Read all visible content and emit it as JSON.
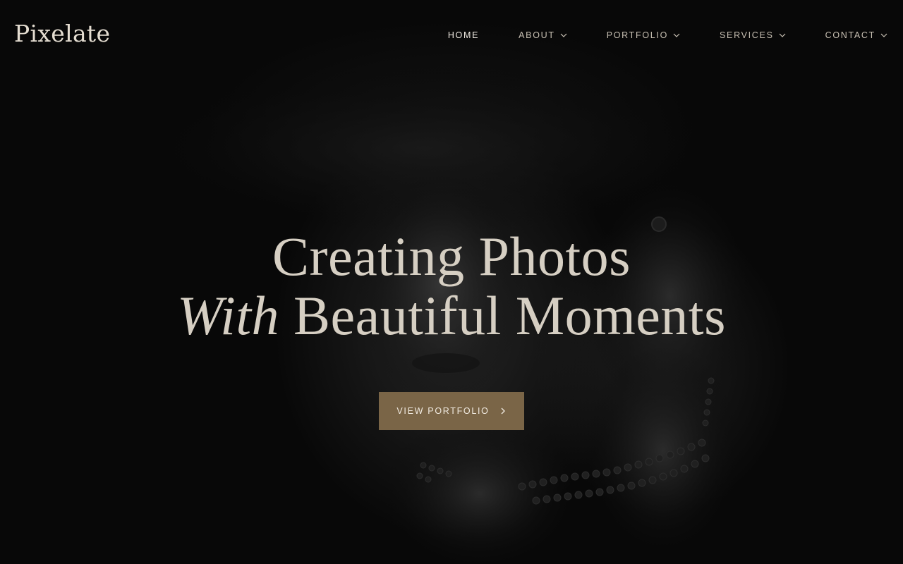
{
  "brand": {
    "logo_text": "Pixelate"
  },
  "nav": {
    "items": [
      {
        "label": "HOME",
        "active": true,
        "has_dropdown": false
      },
      {
        "label": "ABOUT",
        "active": false,
        "has_dropdown": true
      },
      {
        "label": "PORTFOLIO",
        "active": false,
        "has_dropdown": true
      },
      {
        "label": "SERVICES",
        "active": false,
        "has_dropdown": true
      },
      {
        "label": "CONTACT",
        "active": false,
        "has_dropdown": true
      }
    ]
  },
  "hero": {
    "headline_line1": "Creating Photos",
    "headline_italic": "With",
    "headline_line2_rest": "Beautiful Moments",
    "cta_label": "VIEW PORTFOLIO",
    "background_image": "dark-portrait-woman-hat-pearls"
  },
  "colors": {
    "background": "#080808",
    "text": "#d6cfc3",
    "accent": "#7a6547"
  },
  "icons": {
    "nav_dropdown": "chevron-down-icon",
    "cta_arrow": "chevron-right-icon"
  }
}
